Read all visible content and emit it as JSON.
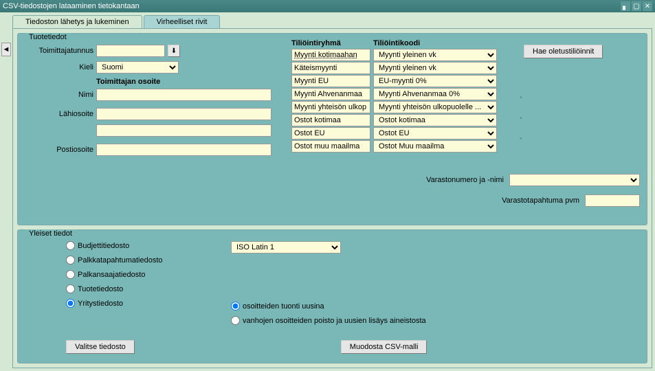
{
  "window": {
    "title": "CSV-tiedostojen lataaminen tietokantaan"
  },
  "tabs": {
    "active": "Tiedoston lähetys ja lukeminen",
    "inactive": "Virheelliset rivit"
  },
  "product": {
    "legend": "Tuotetiedot",
    "supplier_label": "Toimittajatunnus",
    "language_label": "Kieli",
    "language_value": "Suomi",
    "address_heading": "Toimittajan osoite",
    "name_label": "Nimi",
    "street_label": "Lähiosoite",
    "postal_label": "Postiosoite",
    "group_header": "Tiliöintiryhmä",
    "code_header": "Tiliöintikoodi",
    "accounts": [
      {
        "group": "Myynti kotimaahan",
        "code": "Myynti yleinen vk"
      },
      {
        "group": "Käteismyynti",
        "code": "Myynti yleinen vk"
      },
      {
        "group": "Myynti EU",
        "code": "EU-myynti 0%"
      },
      {
        "group": "Myynti Ahvenanmaa",
        "code": "Myynti Ahvenanmaa 0%"
      },
      {
        "group": "Myynti yhteisön ulkop",
        "code": "Myynti yhteisön ulkopuolelle ..."
      },
      {
        "group": "Ostot kotimaa",
        "code": "Ostot kotimaa"
      },
      {
        "group": "Ostot EU",
        "code": "Ostot EU"
      },
      {
        "group": "Ostot muu maailma",
        "code": "Ostot Muu maailma"
      }
    ],
    "default_btn": "Hae oletustiliöinnit",
    "warehouse_label": "Varastonumero ja -nimi",
    "stock_date_label": "Varastotapahtuma pvm"
  },
  "general": {
    "legend": "Yleiset tiedot",
    "file_types": [
      "Budjettitiedosto",
      "Palkkatapahtumatiedosto",
      "Palkansaajatiedosto",
      "Tuotetiedosto",
      "Yritystiedosto"
    ],
    "selected_type": "Yritystiedosto",
    "encoding": "ISO Latin 1",
    "addr_option1": "osoitteiden tuonti uusina",
    "addr_option2": "vanhojen osoitteiden poisto ja uusien lisäys aineistosta",
    "choose_btn": "Valitse tiedosto",
    "csv_btn": "Muodosta CSV-malli"
  }
}
